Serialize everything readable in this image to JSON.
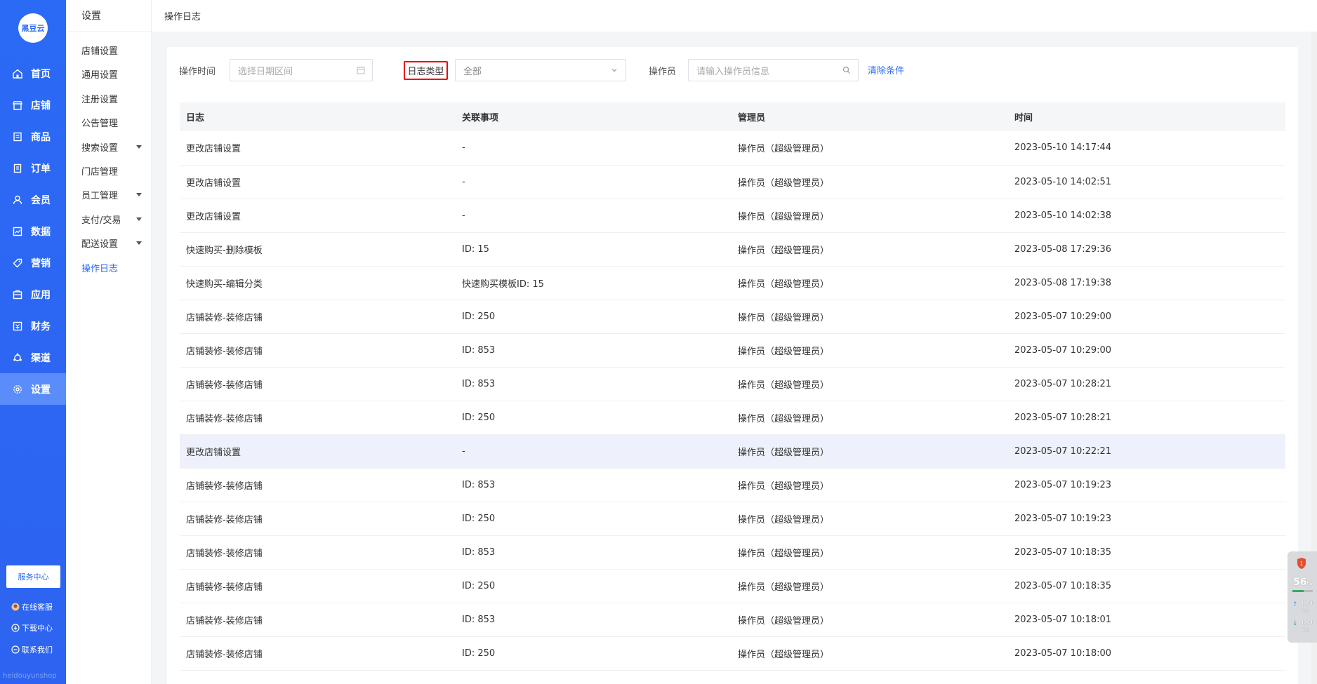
{
  "brand": {
    "logo_text": "黑豆云"
  },
  "main_nav": [
    {
      "label": "首页",
      "icon": "home-icon"
    },
    {
      "label": "店铺",
      "icon": "store-icon"
    },
    {
      "label": "商品",
      "icon": "goods-icon"
    },
    {
      "label": "订单",
      "icon": "order-icon"
    },
    {
      "label": "会员",
      "icon": "member-icon"
    },
    {
      "label": "数据",
      "icon": "data-icon"
    },
    {
      "label": "营销",
      "icon": "tag-icon"
    },
    {
      "label": "应用",
      "icon": "app-icon"
    },
    {
      "label": "财务",
      "icon": "finance-icon"
    },
    {
      "label": "渠道",
      "icon": "channel-icon"
    },
    {
      "label": "设置",
      "icon": "gear-icon"
    }
  ],
  "service": {
    "button": "服务中心",
    "links": [
      "在线客服",
      "下载中心",
      "联系我们"
    ],
    "footer_text": "heidouyunshop"
  },
  "sub_nav": {
    "title": "设置",
    "items": [
      {
        "label": "店铺设置",
        "caret": false
      },
      {
        "label": "通用设置",
        "caret": false
      },
      {
        "label": "注册设置",
        "caret": false
      },
      {
        "label": "公告管理",
        "caret": false
      },
      {
        "label": "搜索设置",
        "caret": true
      },
      {
        "label": "门店管理",
        "caret": false
      },
      {
        "label": "员工管理",
        "caret": true
      },
      {
        "label": "支付/交易",
        "caret": true
      },
      {
        "label": "配送设置",
        "caret": true
      },
      {
        "label": "操作日志",
        "caret": false
      }
    ]
  },
  "header": {
    "title": "操作日志"
  },
  "filters": {
    "time_label": "操作时间",
    "date_placeholder": "选择日期区间",
    "type_label": "日志类型",
    "type_value": "全部",
    "operator_label": "操作员",
    "operator_placeholder": "请输入操作员信息",
    "clear": "清除条件"
  },
  "table": {
    "columns": [
      "日志",
      "关联事项",
      "管理员",
      "时间"
    ],
    "rows": [
      [
        "更改店铺设置",
        "-",
        "操作员（超级管理员）",
        "2023-05-10 14:17:44"
      ],
      [
        "更改店铺设置",
        "-",
        "操作员（超级管理员）",
        "2023-05-10 14:02:51"
      ],
      [
        "更改店铺设置",
        "-",
        "操作员（超级管理员）",
        "2023-05-10 14:02:38"
      ],
      [
        "快速购买-删除模板",
        "ID: 15",
        "操作员（超级管理员）",
        "2023-05-08 17:29:36"
      ],
      [
        "快速购买-编辑分类",
        "快速购买模板ID: 15",
        "操作员（超级管理员）",
        "2023-05-08 17:19:38"
      ],
      [
        "店铺装修-装修店铺",
        "ID: 250",
        "操作员（超级管理员）",
        "2023-05-07 10:29:00"
      ],
      [
        "店铺装修-装修店铺",
        "ID: 853",
        "操作员（超级管理员）",
        "2023-05-07 10:29:00"
      ],
      [
        "店铺装修-装修店铺",
        "ID: 853",
        "操作员（超级管理员）",
        "2023-05-07 10:28:21"
      ],
      [
        "店铺装修-装修店铺",
        "ID: 250",
        "操作员（超级管理员）",
        "2023-05-07 10:28:21"
      ],
      [
        "更改店铺设置",
        "-",
        "操作员（超级管理员）",
        "2023-05-07 10:22:21"
      ],
      [
        "店铺装修-装修店铺",
        "ID: 853",
        "操作员（超级管理员）",
        "2023-05-07 10:19:23"
      ],
      [
        "店铺装修-装修店铺",
        "ID: 250",
        "操作员（超级管理员）",
        "2023-05-07 10:19:23"
      ],
      [
        "店铺装修-装修店铺",
        "ID: 853",
        "操作员（超级管理员）",
        "2023-05-07 10:18:35"
      ],
      [
        "店铺装修-装修店铺",
        "ID: 250",
        "操作员（超级管理员）",
        "2023-05-07 10:18:35"
      ],
      [
        "店铺装修-装修店铺",
        "ID: 853",
        "操作员（超级管理员）",
        "2023-05-07 10:18:01"
      ],
      [
        "店铺装修-装修店铺",
        "ID: 250",
        "操作员（超级管理员）",
        "2023-05-07 10:18:00"
      ]
    ]
  },
  "widget": {
    "badge": "1",
    "percent": "56",
    "percent_unit": "%",
    "up": "0.0",
    "down": "0.0",
    "unit": "K/s",
    "bar_fill": 0.56
  },
  "colors": {
    "primary": "#2b6af5",
    "highlight_border": "#ee0000"
  }
}
